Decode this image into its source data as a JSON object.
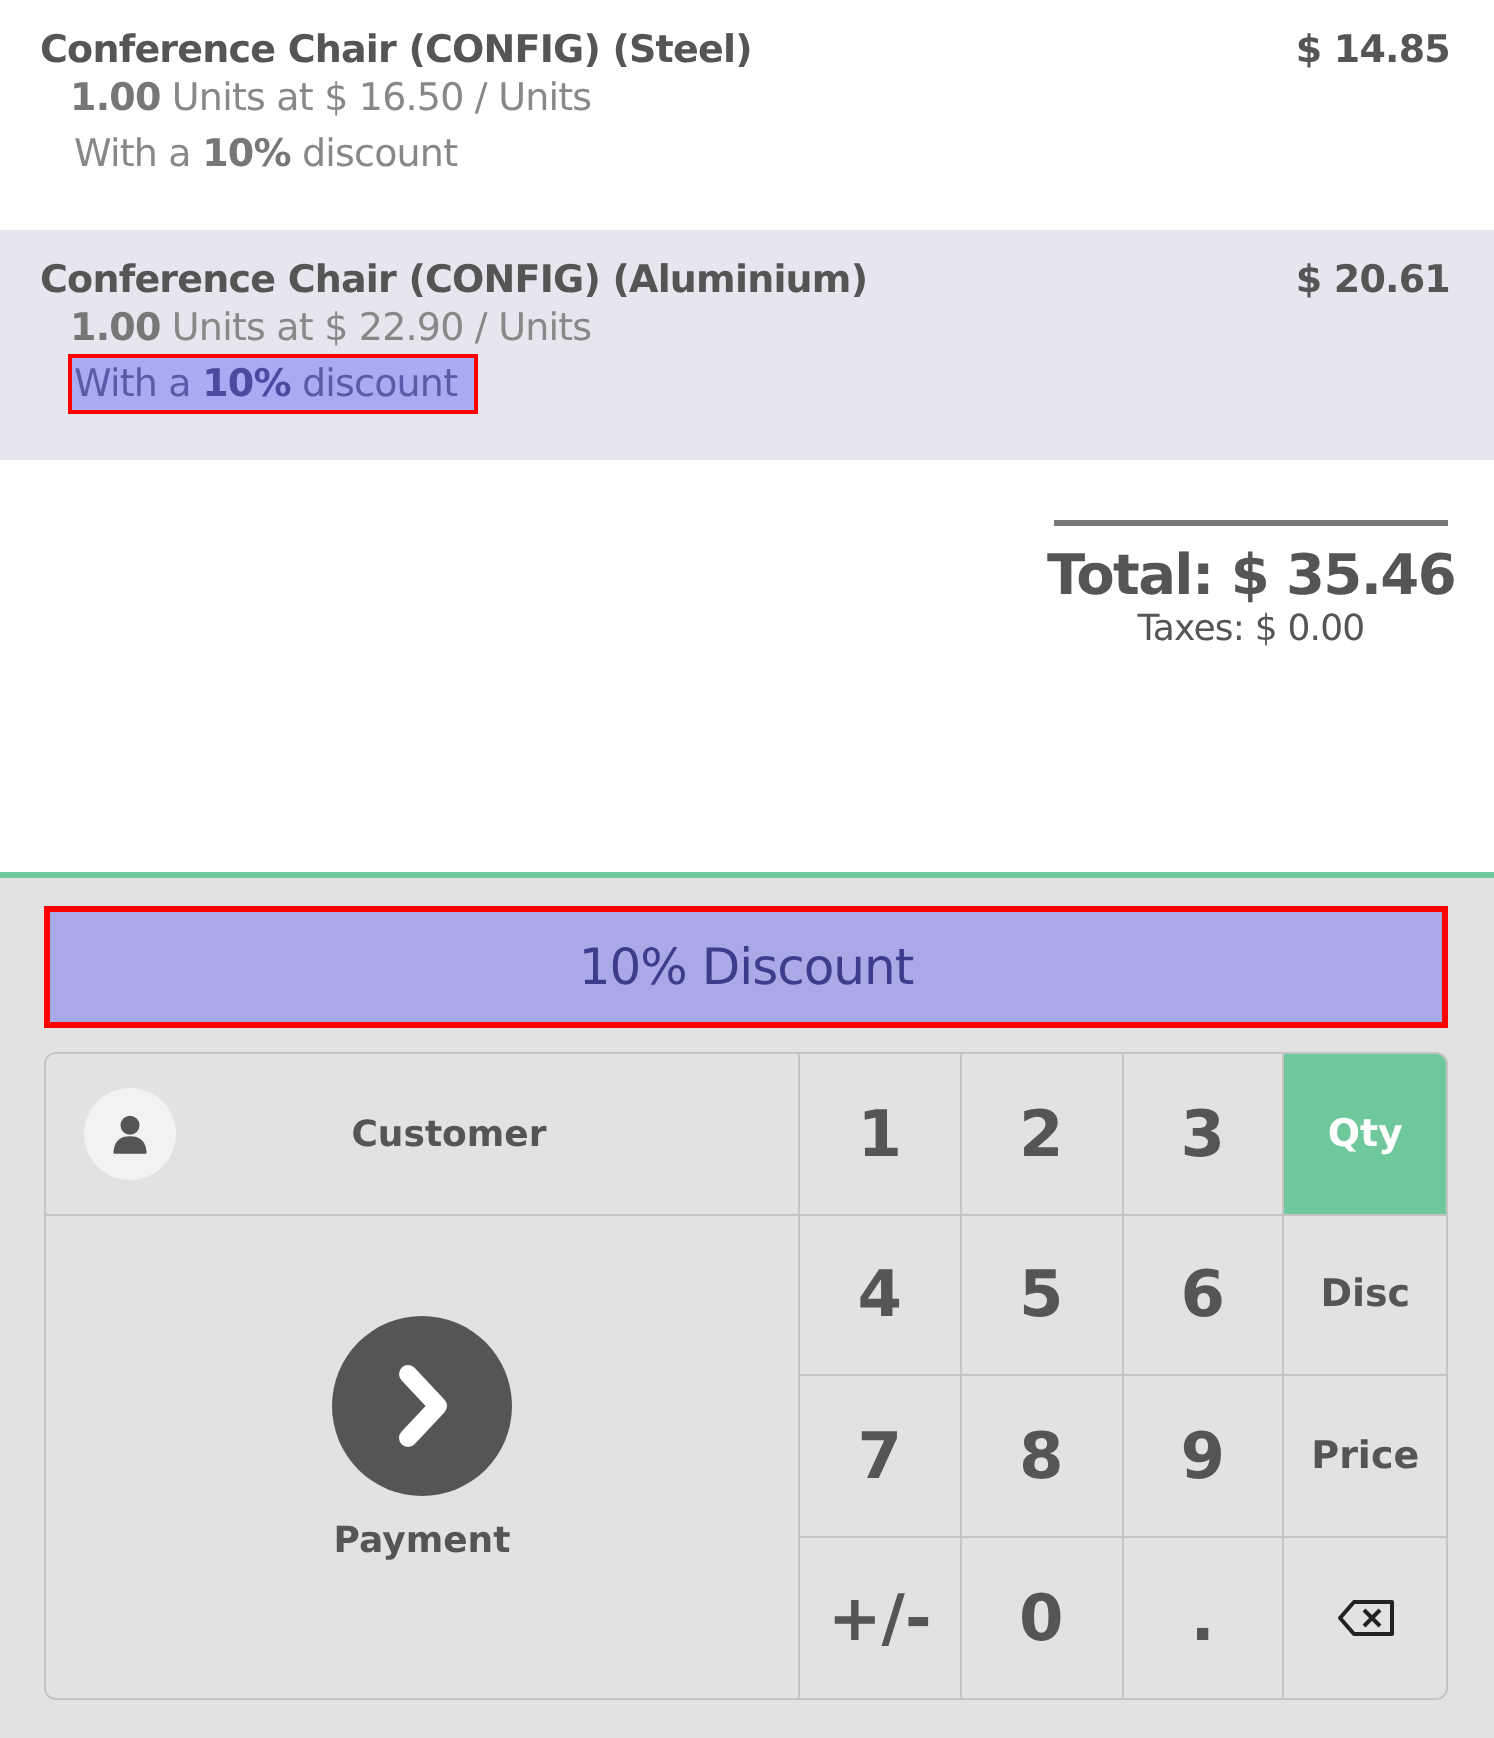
{
  "order_lines": [
    {
      "product": "Conference Chair (CONFIG) (Steel)",
      "price": "$ 14.85",
      "quantity": "1.00",
      "unit_text": "Units at $ 16.50 / Units",
      "discount": {
        "text": "With a **10%** discount",
        "highlighted": false
      },
      "selected": false
    },
    {
      "product": "Conference Chair (CONFIG) (Aluminium)",
      "price": "$ 20.61",
      "quantity": "1.00",
      "unit_text": "Units at $ 22.90 / Units",
      "discount": {
        "text": "With a **10%** discount",
        "highlighted": true
      },
      "selected": true
    }
  ],
  "summary": {
    "total": "Total: $ 35.46",
    "taxes": "Taxes: $ 0.00"
  },
  "discount_button": {
    "label": "10% Discount",
    "highlighted": true
  },
  "actions": {
    "customer": "Customer",
    "payment": "Payment"
  },
  "numpad": [
    {
      "kind": "digit",
      "label": "1",
      "selected": false
    },
    {
      "kind": "digit",
      "label": "2",
      "selected": false
    },
    {
      "kind": "digit",
      "label": "3",
      "selected": false
    },
    {
      "kind": "mode",
      "label": "Qty",
      "selected": true
    },
    {
      "kind": "digit",
      "label": "4",
      "selected": false
    },
    {
      "kind": "digit",
      "label": "5",
      "selected": false
    },
    {
      "kind": "digit",
      "label": "6",
      "selected": false
    },
    {
      "kind": "mode",
      "label": "Disc",
      "selected": false
    },
    {
      "kind": "digit",
      "label": "7",
      "selected": false
    },
    {
      "kind": "digit",
      "label": "8",
      "selected": false
    },
    {
      "kind": "digit",
      "label": "9",
      "selected": false
    },
    {
      "kind": "mode",
      "label": "Price",
      "selected": false
    },
    {
      "kind": "digit",
      "label": "+/-",
      "selected": false
    },
    {
      "kind": "digit",
      "label": "0",
      "selected": false
    },
    {
      "kind": "digit",
      "label": ".",
      "selected": false
    },
    {
      "kind": "backspace",
      "selected": false
    }
  ]
}
